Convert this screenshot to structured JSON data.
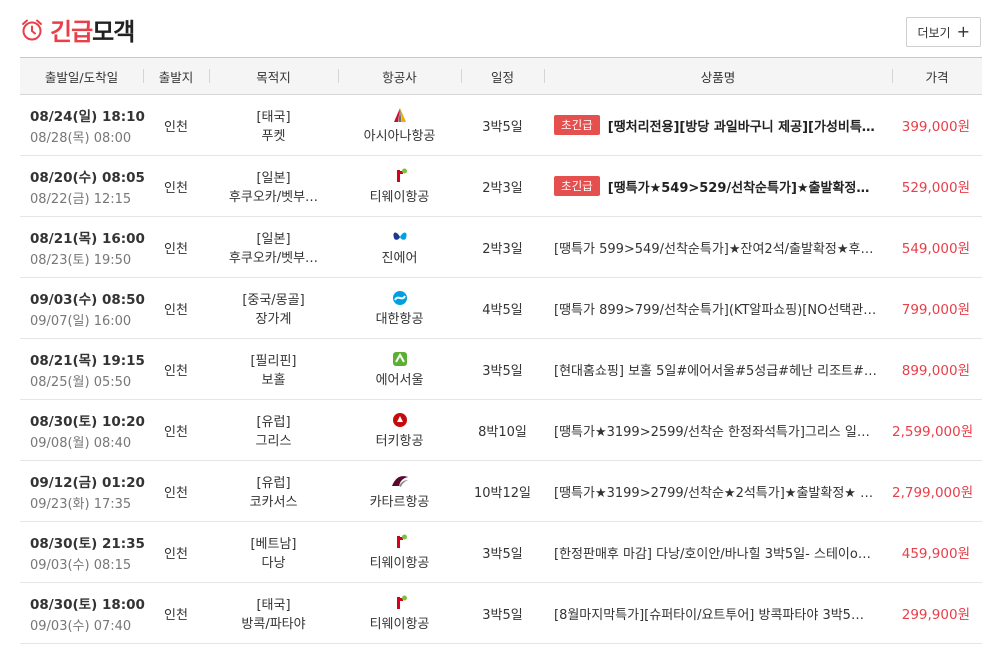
{
  "header": {
    "title_accent": "긴급",
    "title_rest": "모객",
    "more_label": "더보기",
    "more_plus": "+",
    "accent_color": "#e8404a"
  },
  "columns": [
    "출발일/도착일",
    "출발지",
    "목적지",
    "항공사",
    "일정",
    "상품명",
    "가격"
  ],
  "rows": [
    {
      "dep": "08/24(일) 18:10",
      "arr": "08/28(목) 08:00",
      "origin": "인천",
      "region": "[태국]",
      "city": "푸켓",
      "airline": "아시아나항공",
      "airline_icon": "asiana-logo-icon",
      "schedule": "3박5일",
      "badge": "초긴급",
      "product": "[땡처리전용][방당 과일바구니 제공][가성비특…",
      "price": "399,000원"
    },
    {
      "dep": "08/20(수) 08:05",
      "arr": "08/22(금) 12:15",
      "origin": "인천",
      "region": "[일본]",
      "city": "후쿠오카/벳부…",
      "airline": "티웨이항공",
      "airline_icon": "tway-logo-icon",
      "schedule": "2박3일",
      "badge": "초긴급",
      "product": "[땡특가★549>529/선착순특가]★출발확정…",
      "price": "529,000원"
    },
    {
      "dep": "08/21(목) 16:00",
      "arr": "08/23(토) 19:50",
      "origin": "인천",
      "region": "[일본]",
      "city": "후쿠오카/벳부…",
      "airline": "진에어",
      "airline_icon": "jinair-logo-icon",
      "schedule": "2박3일",
      "badge": "",
      "product": "[땡특가 599>549/선착순특가]★잔여2석/출발확정★후…",
      "price": "549,000원"
    },
    {
      "dep": "09/03(수) 08:50",
      "arr": "09/07(일) 16:00",
      "origin": "인천",
      "region": "[중국/몽골]",
      "city": "장가계",
      "airline": "대한항공",
      "airline_icon": "koreanair-logo-icon",
      "schedule": "4박5일",
      "badge": "",
      "product": "[땡특가 899>799/선착순특가](KT알파쇼핑)[NO선택관…",
      "price": "799,000원"
    },
    {
      "dep": "08/21(목) 19:15",
      "arr": "08/25(월) 05:50",
      "origin": "인천",
      "region": "[필리핀]",
      "city": "보홀",
      "airline": "에어서울",
      "airline_icon": "airseoul-logo-icon",
      "schedule": "3박5일",
      "badge": "",
      "product": "[현대홈쇼핑] 보홀 5일#에어서울#5성급#헤난 리조트#…",
      "price": "899,000원"
    },
    {
      "dep": "08/30(토) 10:20",
      "arr": "09/08(월) 08:40",
      "origin": "인천",
      "region": "[유럽]",
      "city": "그리스",
      "airline": "터키항공",
      "airline_icon": "turkish-logo-icon",
      "schedule": "8박10일",
      "badge": "",
      "product": "[땡특가★3199>2599/선착순 한정좌석특가]그리스 일…",
      "price": "2,599,000원"
    },
    {
      "dep": "09/12(금) 01:20",
      "arr": "09/23(화) 17:35",
      "origin": "인천",
      "region": "[유럽]",
      "city": "코카서스",
      "airline": "카타르항공",
      "airline_icon": "qatar-logo-icon",
      "schedule": "10박12일",
      "badge": "",
      "product": "[땡특가★3199>2799/선착순★2석특가]★출발확정★ …",
      "price": "2,799,000원"
    },
    {
      "dep": "08/30(토) 21:35",
      "arr": "09/03(수) 08:15",
      "origin": "인천",
      "region": "[베트남]",
      "city": "다낭",
      "airline": "티웨이항공",
      "airline_icon": "tway-logo-icon",
      "schedule": "3박5일",
      "badge": "",
      "product": "[한정판매후 마감] 다낭/호이안/바나힐 3박5일- 스테이o…",
      "price": "459,900원"
    },
    {
      "dep": "08/30(토) 18:00",
      "arr": "09/03(수) 07:40",
      "origin": "인천",
      "region": "[태국]",
      "city": "방콕/파타야",
      "airline": "티웨이항공",
      "airline_icon": "tway-logo-icon",
      "schedule": "3박5일",
      "badge": "",
      "product": "[8월마지막특가][슈퍼타이/요트투어] 방콕파타야 3박5…",
      "price": "299,900원"
    }
  ]
}
